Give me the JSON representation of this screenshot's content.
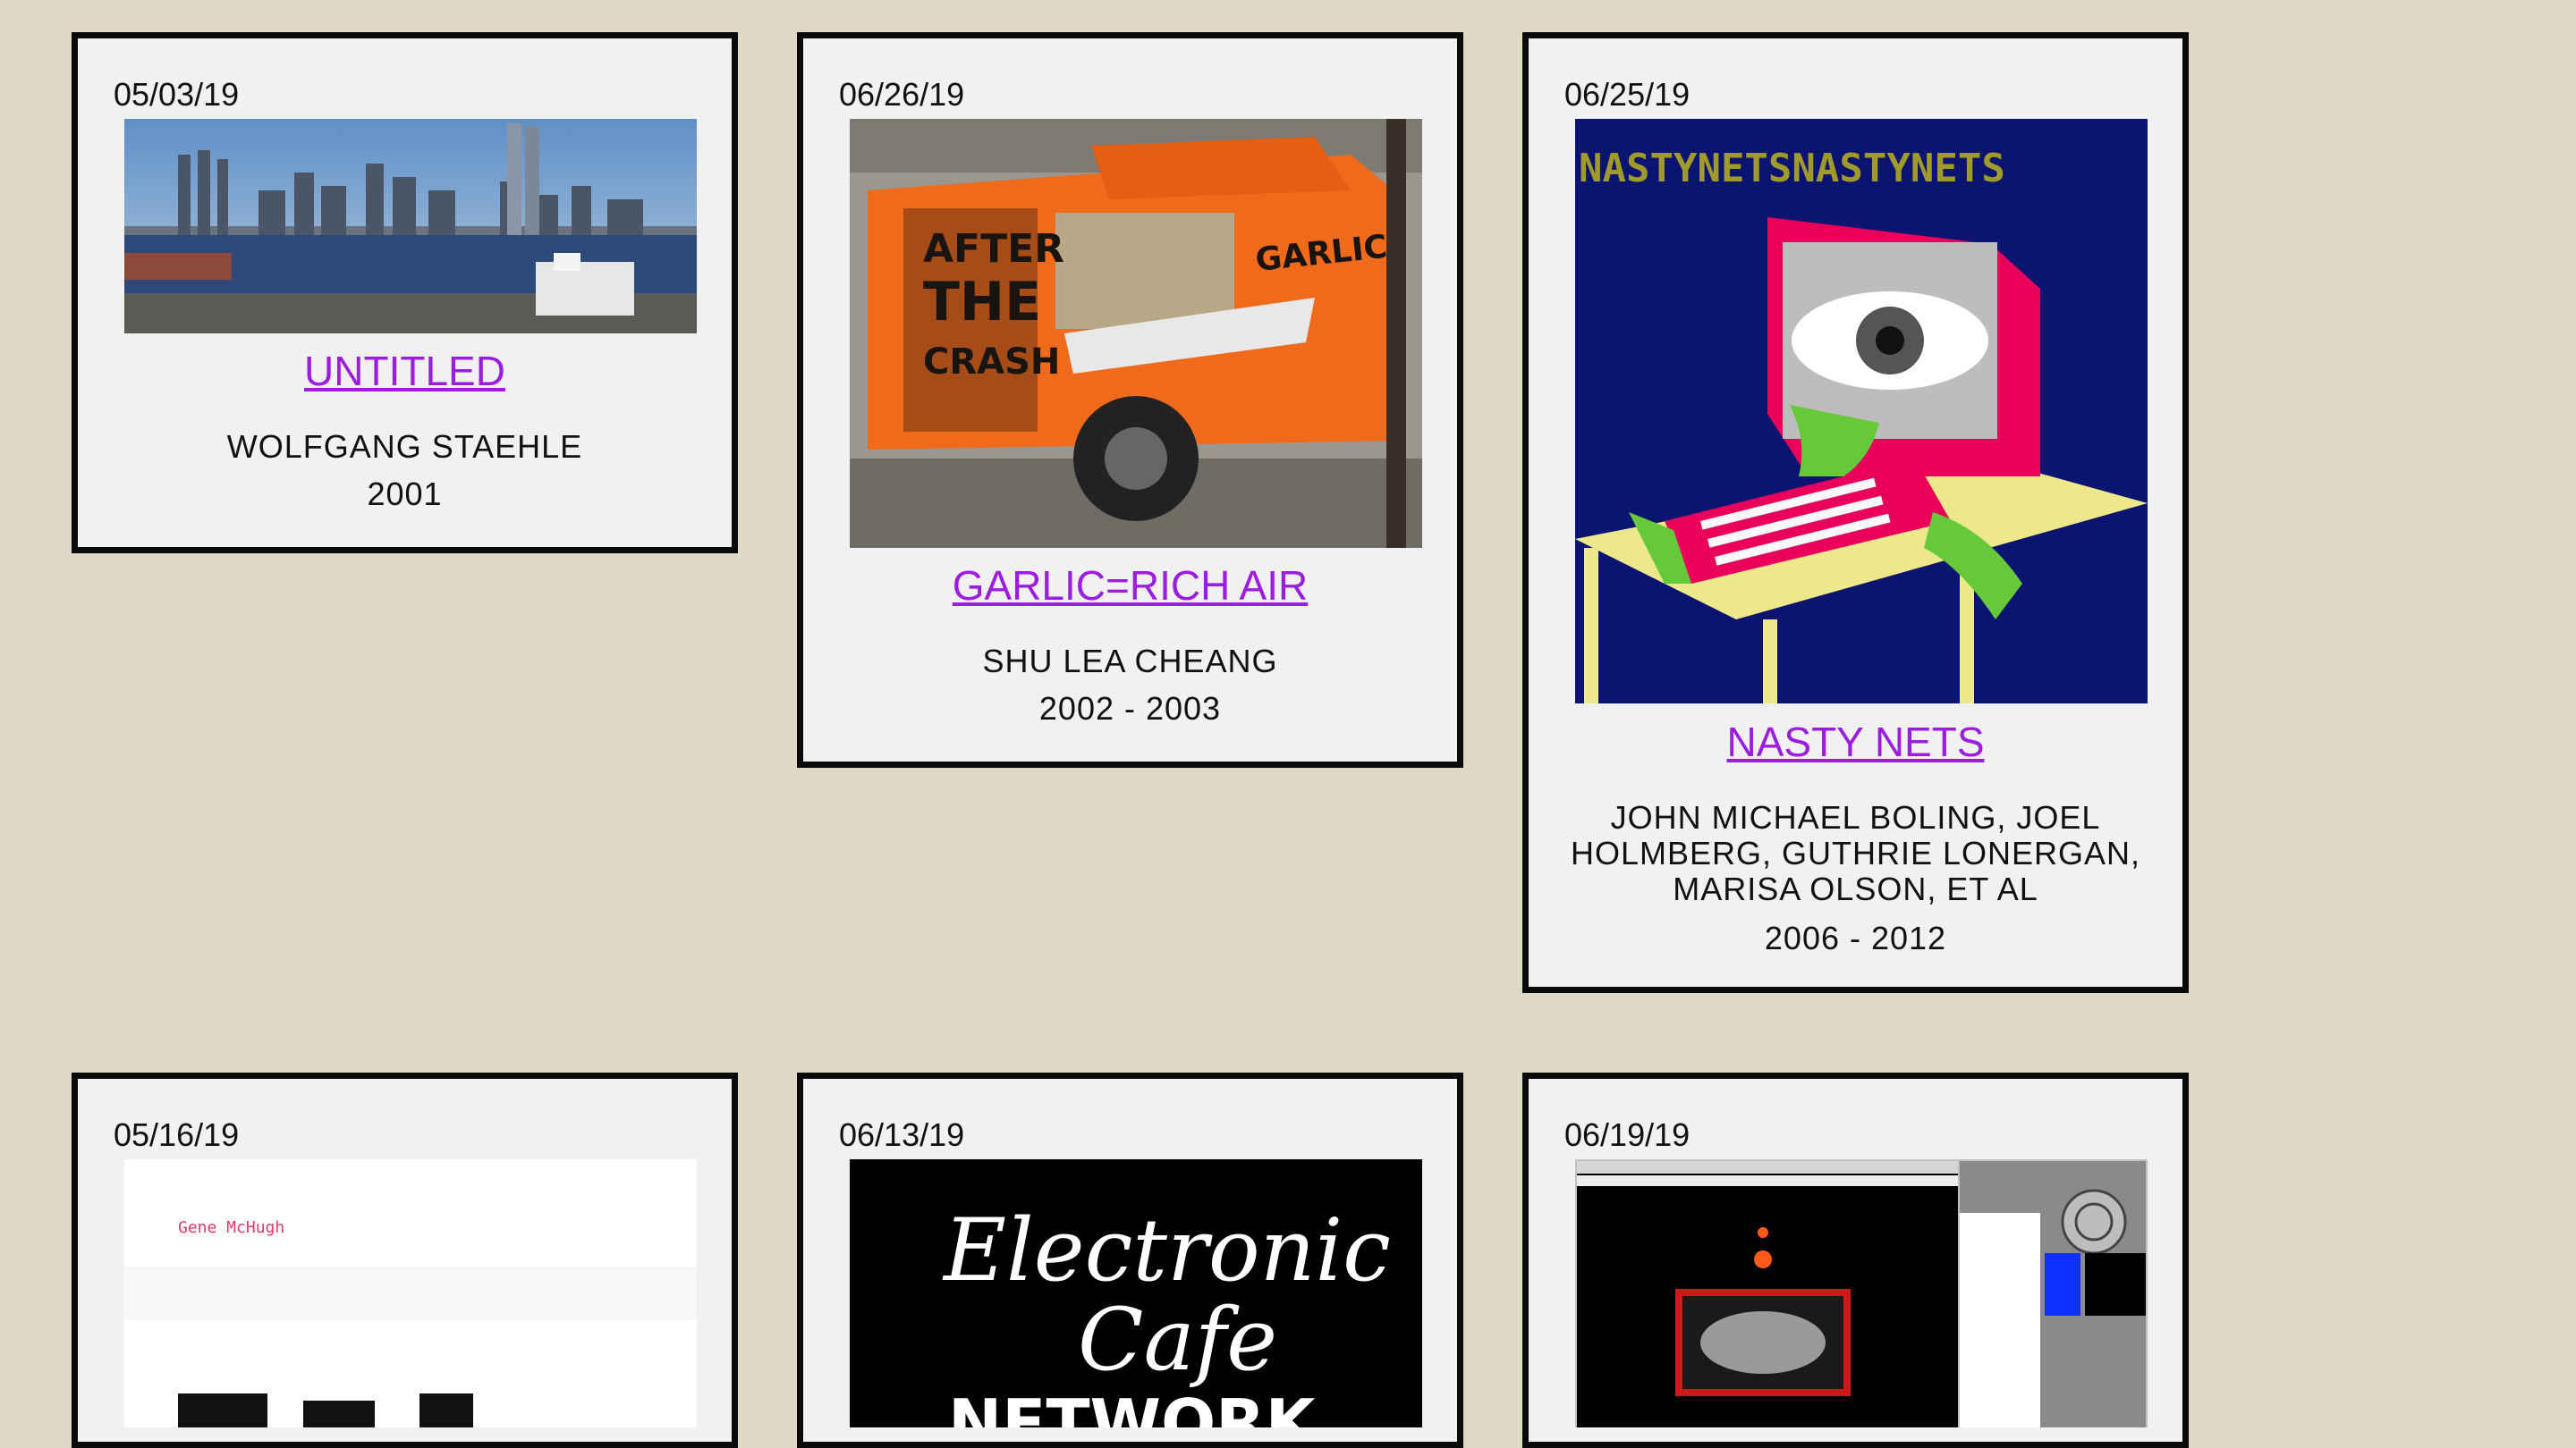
{
  "cards": [
    {
      "date": "05/03/19",
      "title": "UNTITLED",
      "artist": "WOLFGANG STAEHLE",
      "years": "2001"
    },
    {
      "date": "06/26/19",
      "title": "GARLIC=RICH AIR",
      "artist": "SHU LEA CHEANG",
      "years": "2002 - 2003"
    },
    {
      "date": "06/25/19",
      "title": "NASTY NETS",
      "artist": "JOHN MICHAEL BOLING, JOEL HOLMBERG, GUTHRIE LONERGAN, MARISA OLSON, ET AL",
      "years": "2006 - 2012"
    },
    {
      "date": "05/16/19"
    },
    {
      "date": "06/13/19"
    },
    {
      "date": "06/19/19"
    }
  ],
  "images": {
    "truck_text_1": "AFTER",
    "truck_text_2": "THE",
    "truck_text_3": "CRASH",
    "truck_text_4": "GARLIC",
    "nasty_banner": "NASTYNETSNASTYNETS",
    "book_author": "Gene McHugh",
    "cafe_line1": "Electronic",
    "cafe_line2": "Cafe",
    "cafe_line3": "NETWORK"
  }
}
